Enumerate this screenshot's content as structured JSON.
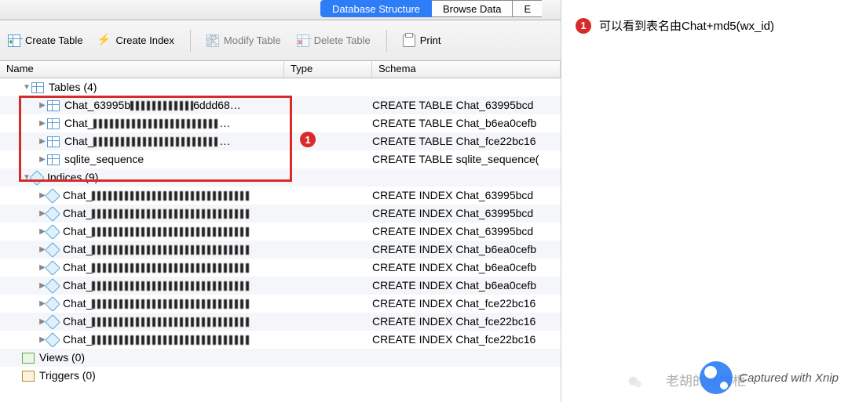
{
  "tabs": {
    "structure": "Database Structure",
    "browse": "Browse Data",
    "edit_partial": "E"
  },
  "toolbar": {
    "create_table": "Create Table",
    "create_index": "Create Index",
    "modify_table": "Modify Table",
    "delete_table": "Delete Table",
    "print": "Print"
  },
  "columns": {
    "name": "Name",
    "type": "Type",
    "schema": "Schema"
  },
  "tree": {
    "tables_header": "Tables (4)",
    "tables": [
      {
        "name_prefix": "Chat_63995b",
        "name_suffix": "6ddd68…",
        "schema": "CREATE TABLE Chat_63995bcd"
      },
      {
        "name_prefix": "Chat_",
        "name_suffix": "…",
        "schema": "CREATE TABLE Chat_b6ea0cefb"
      },
      {
        "name_prefix": "Chat_",
        "name_suffix": "…",
        "schema": "CREATE TABLE Chat_fce22bc16"
      },
      {
        "name_prefix": "sqlite_sequence",
        "name_suffix": "",
        "schema": "CREATE TABLE sqlite_sequence("
      }
    ],
    "indices_header": "Indices (9)",
    "indices": [
      {
        "name_prefix": "Chat_",
        "schema": "CREATE INDEX Chat_63995bcd"
      },
      {
        "name_prefix": "Chat_",
        "schema": "CREATE INDEX Chat_63995bcd"
      },
      {
        "name_prefix": "Chat_",
        "schema": "CREATE INDEX Chat_63995bcd"
      },
      {
        "name_prefix": "Chat_",
        "schema": "CREATE INDEX Chat_b6ea0cefb"
      },
      {
        "name_prefix": "Chat_",
        "schema": "CREATE INDEX Chat_b6ea0cefb"
      },
      {
        "name_prefix": "Chat_",
        "schema": "CREATE INDEX Chat_b6ea0cefb"
      },
      {
        "name_prefix": "Chat_",
        "schema": "CREATE INDEX Chat_fce22bc16"
      },
      {
        "name_prefix": "Chat_",
        "schema": "CREATE INDEX Chat_fce22bc16"
      },
      {
        "name_prefix": "Chat_",
        "schema": "CREATE INDEX Chat_fce22bc16"
      }
    ],
    "views_header": "Views (0)",
    "triggers_header": "Triggers (0)"
  },
  "annotation": {
    "badge": "1",
    "text": "可以看到表名由Chat+md5(wx_id)"
  },
  "watermark": {
    "brand": "老胡的储物柜",
    "captured": "Captured with Xnip"
  }
}
